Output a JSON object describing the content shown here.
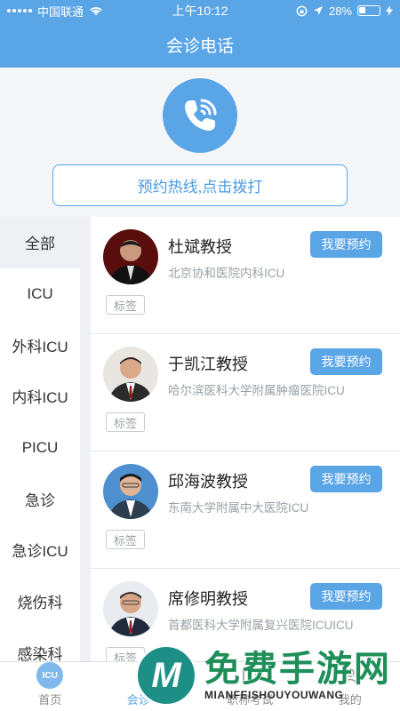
{
  "status_bar": {
    "carrier": "中国联通",
    "time": "上午10:12",
    "battery": "28%"
  },
  "nav": {
    "title": "会诊电话"
  },
  "hero": {
    "hotline_label": "预约热线,点击拨打"
  },
  "sidebar": {
    "items": [
      {
        "label": "全部"
      },
      {
        "label": "ICU"
      },
      {
        "label": "外科ICU"
      },
      {
        "label": "内科ICU"
      },
      {
        "label": "PICU"
      },
      {
        "label": "急诊"
      },
      {
        "label": "急诊ICU"
      },
      {
        "label": "烧伤科"
      },
      {
        "label": "感染科"
      }
    ],
    "active_index": 0
  },
  "doctors": [
    {
      "name": "杜斌教授",
      "hospital": "北京协和医院内科ICU",
      "book_label": "我要预约",
      "tag": "标签"
    },
    {
      "name": "于凯江教授",
      "hospital": "哈尔滨医科大学附属肿瘤医院ICU",
      "book_label": "我要预约",
      "tag": "标签"
    },
    {
      "name": "邱海波教授",
      "hospital": "东南大学附属中大医院ICU",
      "book_label": "我要预约",
      "tag": "标签"
    },
    {
      "name": "席修明教授",
      "hospital": "首都医科大学附属复兴医院ICUICU",
      "book_label": "我要预约",
      "tag": "标签"
    }
  ],
  "tabbar": {
    "tabs": [
      {
        "label": "首页",
        "icon": "icu-logo-icon"
      },
      {
        "label": "会诊电话",
        "icon": "phone-icon"
      },
      {
        "label": "职称考试",
        "icon": "book-icon"
      },
      {
        "label": "我的",
        "icon": "user-icon"
      }
    ],
    "active_index": 1
  },
  "watermark": {
    "big": "免费手游网",
    "small": "MIANFEISHOUYOUWANG",
    "logo_letter": "M"
  },
  "colors": {
    "accent": "#5aa5e6",
    "background": "#eef0f3"
  }
}
